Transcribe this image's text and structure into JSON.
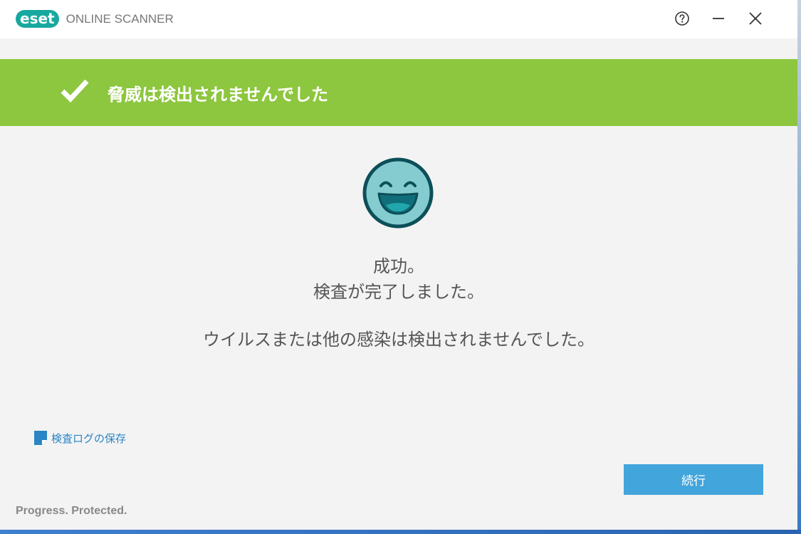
{
  "titlebar": {
    "logo_text": "eset",
    "app_name": "ONLINE SCANNER",
    "help_icon": "question-circle-icon",
    "minimize_icon": "minimize-icon",
    "close_icon": "close-icon"
  },
  "banner": {
    "title": "脅威は検出されませんでした",
    "icon": "checkmark-icon",
    "color": "#8dc63f"
  },
  "result": {
    "icon": "smiley-face-icon",
    "line1": "成功。",
    "line2": "検査が完了しました。",
    "line3": "ウイルスまたは他の感染は検出されませんでした。"
  },
  "actions": {
    "save_log_label": "検査ログの保存",
    "save_log_icon": "document-icon",
    "continue_label": "続行",
    "continue_color": "#42a5db"
  },
  "footer": {
    "tagline": "Progress. Protected."
  }
}
